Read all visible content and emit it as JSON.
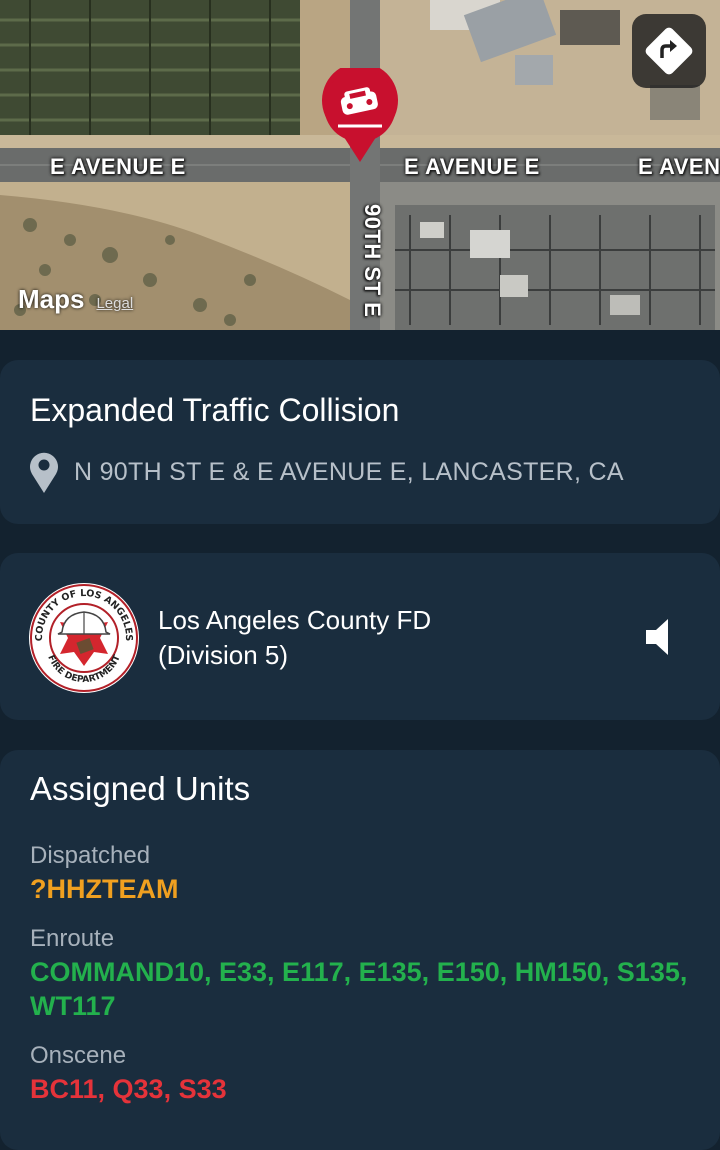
{
  "map": {
    "streets": {
      "avenue_left": "E AVENUE E",
      "avenue_mid": "E AVENUE E",
      "avenue_right": "E AVEN",
      "cross_street": "90TH ST E"
    },
    "brand": "Maps",
    "legal": "Legal",
    "pin_icon": "car-crash-icon",
    "directions_icon": "directions-arrow-icon"
  },
  "incident": {
    "title": "Expanded Traffic Collision",
    "address": "N 90TH ST E & E AVENUE E, LANCASTER, CA",
    "location_icon": "location-pin-icon"
  },
  "agency": {
    "name_line1": "Los Angeles County FD",
    "name_line2": "(Division 5)",
    "logo_text_top": "COUNTY OF LOS ANGELES",
    "logo_text_bottom": "FIRE DEPARTMENT",
    "speaker_icon": "speaker-icon"
  },
  "units": {
    "title": "Assigned Units",
    "dispatched": {
      "label": "Dispatched",
      "value": "?HHZTEAM"
    },
    "enroute": {
      "label": "Enroute",
      "value": "COMMAND10, E33, E117, E135, E150, HM150, S135, WT117"
    },
    "onscene": {
      "label": "Onscene",
      "value": "BC11, Q33, S33"
    }
  },
  "colors": {
    "background": "#13222f",
    "card": "#1a2d3e",
    "pin_red": "#c8102e",
    "dispatched": "#f0a020",
    "enroute": "#23b14d",
    "onscene": "#e5333a"
  }
}
